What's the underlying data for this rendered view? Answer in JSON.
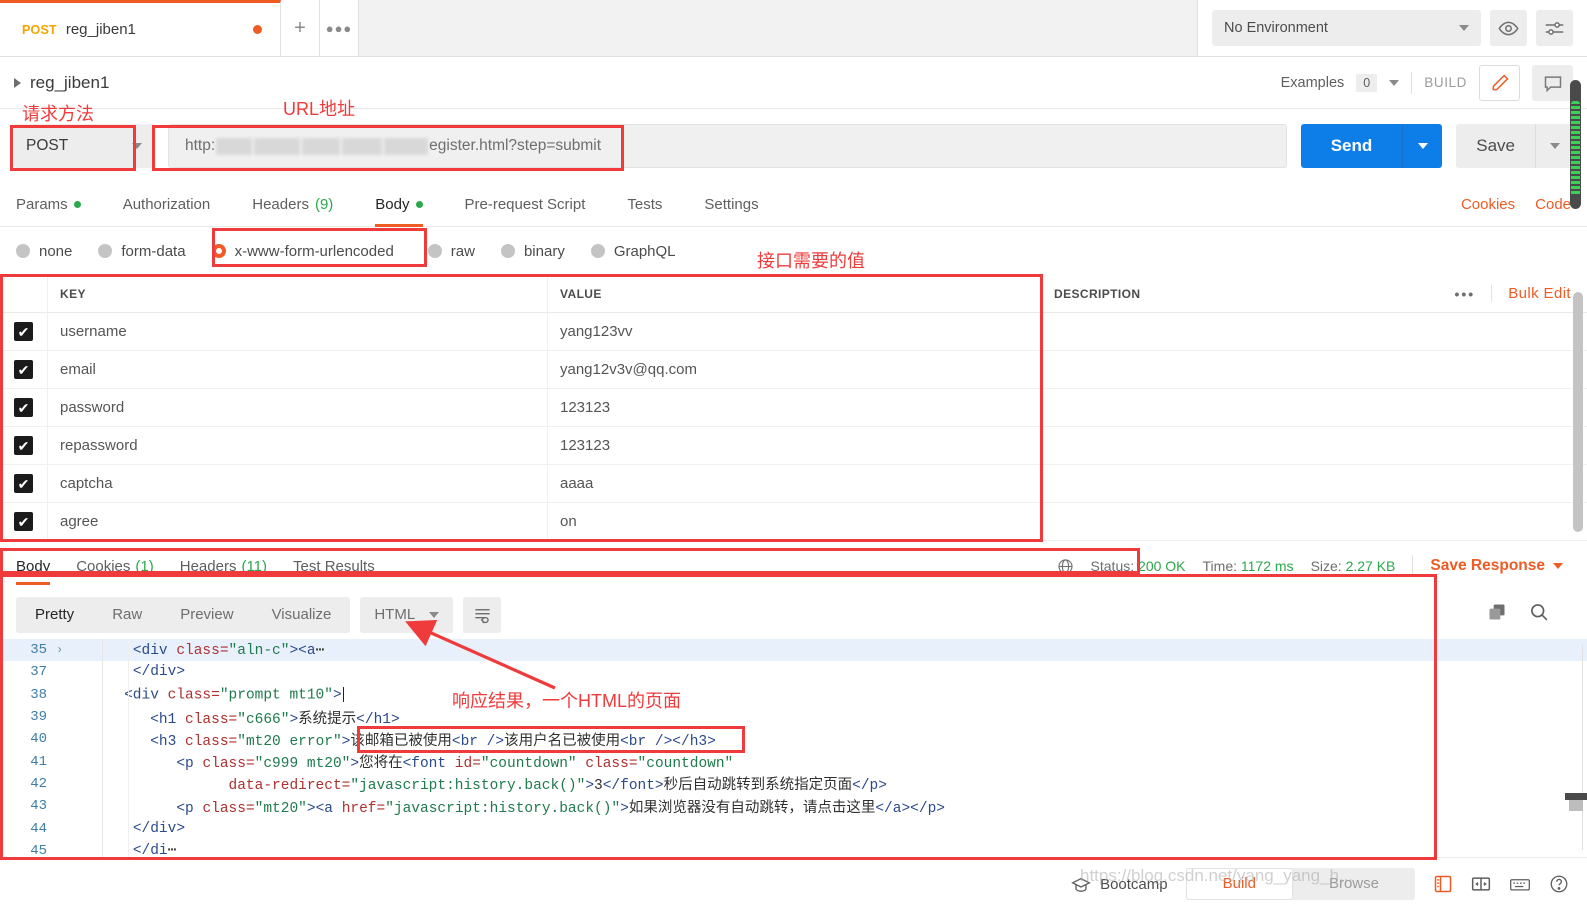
{
  "tab": {
    "method": "POST",
    "name": "reg_jiben1",
    "unsaved_dot": "●",
    "new_tab": "+",
    "more": "●●●"
  },
  "environment": {
    "selected": "No Environment",
    "eye_icon": "eye-icon",
    "settings_icon": "sliders-icon"
  },
  "breadcrumb": {
    "name": "reg_jiben1",
    "examples_label": "Examples",
    "examples_count": "0",
    "build_label": "BUILD",
    "edit_icon": "pencil-icon",
    "comment_icon": "comment-icon"
  },
  "url_bar": {
    "method": "POST",
    "url_prefix": "http:",
    "url_suffix": "egister.html?step=submit",
    "send_label": "Send",
    "save_label": "Save"
  },
  "request_tabs": [
    {
      "label": "Params",
      "badge": "dot",
      "active": false
    },
    {
      "label": "Authorization",
      "badge": "",
      "active": false
    },
    {
      "label": "Headers",
      "badge": "(9)",
      "active": false
    },
    {
      "label": "Body",
      "badge": "dot",
      "active": true
    },
    {
      "label": "Pre-request Script",
      "badge": "",
      "active": false
    },
    {
      "label": "Tests",
      "badge": "",
      "active": false
    },
    {
      "label": "Settings",
      "badge": "",
      "active": false
    }
  ],
  "request_links": {
    "cookies": "Cookies",
    "code": "Code"
  },
  "body_types": [
    {
      "label": "none",
      "selected": false
    },
    {
      "label": "form-data",
      "selected": false
    },
    {
      "label": "x-www-form-urlencoded",
      "selected": true
    },
    {
      "label": "raw",
      "selected": false
    },
    {
      "label": "binary",
      "selected": false
    },
    {
      "label": "GraphQL",
      "selected": false
    }
  ],
  "kv_table": {
    "headers": {
      "key": "KEY",
      "value": "VALUE",
      "description": "DESCRIPTION"
    },
    "bulk_edit": "Bulk Edit",
    "more": "•••",
    "check_glyph": "✔",
    "rows": [
      {
        "checked": true,
        "key": "username",
        "value": "yang123vv",
        "description": ""
      },
      {
        "checked": true,
        "key": "email",
        "value": "yang12v3v@qq.com",
        "description": ""
      },
      {
        "checked": true,
        "key": "password",
        "value": "123123",
        "description": ""
      },
      {
        "checked": true,
        "key": "repassword",
        "value": "123123",
        "description": ""
      },
      {
        "checked": true,
        "key": "captcha",
        "value": "aaaa",
        "description": ""
      },
      {
        "checked": true,
        "key": "agree",
        "value": "on",
        "description": ""
      }
    ]
  },
  "response_tabs": [
    {
      "label": "Body",
      "badge": "",
      "active": true
    },
    {
      "label": "Cookies",
      "badge": "(1)",
      "active": false
    },
    {
      "label": "Headers",
      "badge": "(11)",
      "active": false
    },
    {
      "label": "Test Results",
      "badge": "",
      "active": false
    }
  ],
  "response_status": {
    "globe_icon": "globe-icon",
    "status_label": "Status:",
    "status_value": "200 OK",
    "time_label": "Time:",
    "time_value": "1172 ms",
    "size_label": "Size:",
    "size_value": "2.27 KB",
    "save_response": "Save Response"
  },
  "response_toolbar": {
    "segments": [
      {
        "label": "Pretty",
        "active": true
      },
      {
        "label": "Raw",
        "active": false
      },
      {
        "label": "Preview",
        "active": false
      },
      {
        "label": "Visualize",
        "active": false
      }
    ],
    "format": "HTML",
    "wrap_icon": "word-wrap-icon",
    "copy_icon": "copy-icon",
    "search_icon": "search-icon"
  },
  "code_lines": [
    {
      "num": "35",
      "fold": "›",
      "highlight": true,
      "indent": 4,
      "parts": [
        {
          "t": "tg",
          "s": "<div "
        },
        {
          "t": "at",
          "s": "class="
        },
        {
          "t": "st",
          "s": "\"aln-c\""
        },
        {
          "t": "tg",
          "s": "><a"
        },
        {
          "t": "cn",
          "s": "⋯"
        }
      ]
    },
    {
      "num": "37",
      "fold": "",
      "highlight": false,
      "indent": 4,
      "parts": [
        {
          "t": "tg",
          "s": "</div>"
        }
      ]
    },
    {
      "num": "38",
      "fold": "",
      "highlight": false,
      "indent": 3,
      "caret": true,
      "parts": [
        {
          "t": "tg",
          "s": "<div "
        },
        {
          "t": "at",
          "s": "class="
        },
        {
          "t": "st",
          "s": "\"prompt mt10\""
        },
        {
          "t": "tg",
          "s": ">"
        }
      ]
    },
    {
      "num": "39",
      "fold": "",
      "highlight": false,
      "indent": 6,
      "parts": [
        {
          "t": "tg",
          "s": "<h1 "
        },
        {
          "t": "at",
          "s": "class="
        },
        {
          "t": "st",
          "s": "\"c666\""
        },
        {
          "t": "tg",
          "s": ">"
        },
        {
          "t": "cn",
          "s": "系统提示"
        },
        {
          "t": "tg",
          "s": "</h1>"
        }
      ]
    },
    {
      "num": "40",
      "fold": "",
      "highlight": false,
      "indent": 6,
      "parts": [
        {
          "t": "tg",
          "s": "<h3 "
        },
        {
          "t": "at",
          "s": "class="
        },
        {
          "t": "st",
          "s": "\"mt20 error\""
        },
        {
          "t": "tg",
          "s": ">"
        },
        {
          "t": "cn",
          "s": "该邮箱已被使用"
        },
        {
          "t": "tg",
          "s": "<br />"
        },
        {
          "t": "cn",
          "s": "该用户名已被使用"
        },
        {
          "t": "tg",
          "s": "<br /></h3>"
        }
      ]
    },
    {
      "num": "41",
      "fold": "",
      "highlight": false,
      "indent": 9,
      "parts": [
        {
          "t": "tg",
          "s": "<p "
        },
        {
          "t": "at",
          "s": "class="
        },
        {
          "t": "st",
          "s": "\"c999 mt20\""
        },
        {
          "t": "tg",
          "s": ">"
        },
        {
          "t": "cn",
          "s": "您将在"
        },
        {
          "t": "tg",
          "s": "<font "
        },
        {
          "t": "at",
          "s": "id="
        },
        {
          "t": "st",
          "s": "\"countdown\""
        },
        {
          "t": "at",
          "s": " class="
        },
        {
          "t": "st",
          "s": "\"countdown\""
        }
      ]
    },
    {
      "num": "42",
      "fold": "",
      "highlight": false,
      "indent": 15,
      "parts": [
        {
          "t": "at",
          "s": "data-redirect="
        },
        {
          "t": "st",
          "s": "\"javascript:history.back()\""
        },
        {
          "t": "tg",
          "s": ">"
        },
        {
          "t": "cn",
          "s": "3"
        },
        {
          "t": "tg",
          "s": "</font>"
        },
        {
          "t": "cn",
          "s": "秒后自动跳转到系统指定页面"
        },
        {
          "t": "tg",
          "s": "</p>"
        }
      ]
    },
    {
      "num": "43",
      "fold": "",
      "highlight": false,
      "indent": 9,
      "parts": [
        {
          "t": "tg",
          "s": "<p "
        },
        {
          "t": "at",
          "s": "class="
        },
        {
          "t": "st",
          "s": "\"mt20\""
        },
        {
          "t": "tg",
          "s": "><a "
        },
        {
          "t": "at",
          "s": "href="
        },
        {
          "t": "st",
          "s": "\"javascript:history.back()\""
        },
        {
          "t": "tg",
          "s": ">"
        },
        {
          "t": "cn",
          "s": "如果浏览器没有自动跳转，请点击这里"
        },
        {
          "t": "tg",
          "s": "</a></p>"
        }
      ]
    },
    {
      "num": "44",
      "fold": "",
      "highlight": false,
      "indent": 4,
      "parts": [
        {
          "t": "tg",
          "s": "</div>"
        }
      ]
    },
    {
      "num": "45",
      "fold": "",
      "highlight": false,
      "indent": 4,
      "parts": [
        {
          "t": "tg",
          "s": "</di"
        },
        {
          "t": "cn",
          "s": "⋯"
        }
      ]
    }
  ],
  "bottom_bar": {
    "bootcamp_icon": "graduation-cap-icon",
    "bootcamp_label": "Bootcamp",
    "build_label": "Build",
    "browse_label": "Browse",
    "console_icon": "console-icon",
    "layout_icon": "two-pane-icon",
    "keyboard_icon": "keyboard-icon",
    "help_icon": "help-icon"
  },
  "watermark": "https://blog.csdn.net/yang_yang_h...",
  "annotations": {
    "method_label": "请求方法",
    "url_label": "URL地址",
    "values_label": "接口需要的值",
    "response_label": "响应结果，一个HTML的页面",
    "color": "#ef3b3b"
  }
}
